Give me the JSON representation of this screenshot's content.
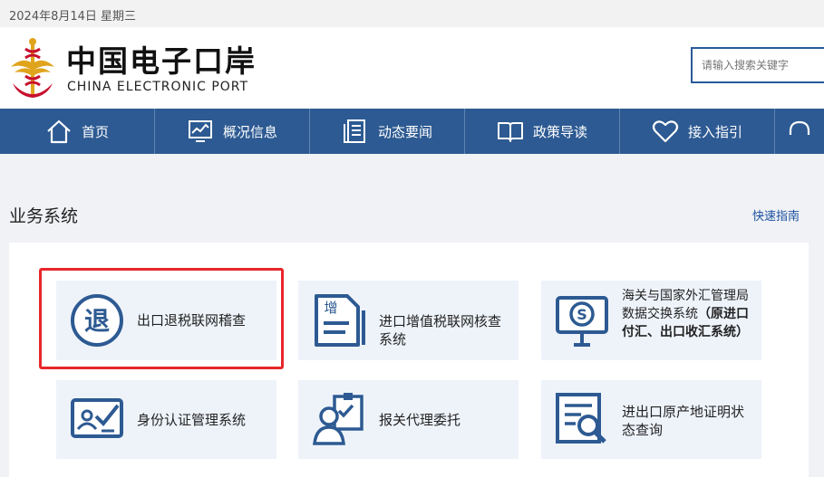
{
  "date": "2024年8月14日  星期三",
  "logo": {
    "cn": "中国电子口岸",
    "en": "CHINA ELECTRONIC PORT"
  },
  "search": {
    "placeholder": "请输入搜索关键字"
  },
  "nav": [
    {
      "label": "首页",
      "icon": "home-icon"
    },
    {
      "label": "概况信息",
      "icon": "chart-monitor-icon"
    },
    {
      "label": "动态要闻",
      "icon": "document-list-icon"
    },
    {
      "label": "政策导读",
      "icon": "open-book-icon"
    },
    {
      "label": "接入指引",
      "icon": "heart-icon"
    }
  ],
  "section": {
    "title": "业务系统",
    "quick_guide": "快速指南"
  },
  "cards": [
    {
      "label": "出口退税联网稽查",
      "icon": "tax-refund-icon",
      "icon_char": "退"
    },
    {
      "label": "进口增值税联网核查系统",
      "icon": "vat-check-icon",
      "icon_char": "增"
    },
    {
      "label": "海关与国家外汇管理局数据交换系统",
      "label_bold": "（原进口付汇、出口收汇系统）",
      "icon": "forex-monitor-icon"
    },
    {
      "label": "身份认证管理系统",
      "icon": "id-card-icon"
    },
    {
      "label": "报关代理委托",
      "icon": "customs-agent-icon"
    },
    {
      "label": "进出口原产地证明状态查询",
      "icon": "certificate-search-icon"
    }
  ],
  "colors": {
    "nav_bg": "#2d5a92",
    "card_bg": "#eef3fa",
    "icon_blue": "#2d5a92",
    "highlight": "#e8262a",
    "logo_red": "#c8102e",
    "logo_gold": "#e0a41c"
  }
}
